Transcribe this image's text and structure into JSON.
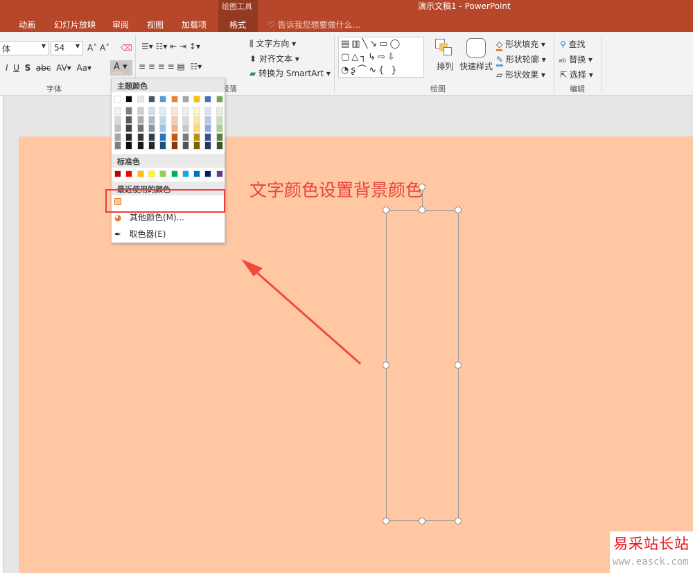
{
  "window": {
    "title": "演示文稿1 - PowerPoint",
    "context_group": "绘图工具"
  },
  "tabs": [
    "动画",
    "幻灯片放映",
    "审阅",
    "视图",
    "加载项",
    "格式"
  ],
  "tell_me": "告诉我您想要做什么...",
  "font": {
    "name": "体",
    "size": "54",
    "group_label": "字体"
  },
  "paragraph": {
    "text_direction": "文字方向",
    "align_text": "对齐文本",
    "smartart": "转换为 SmartArt",
    "group_label": "段落"
  },
  "drawing": {
    "arrange": "排列",
    "quick_styles": "快速样式",
    "shape_fill": "形状填充",
    "shape_outline": "形状轮廓",
    "shape_effects": "形状效果",
    "group_label": "绘图"
  },
  "editing": {
    "find": "查找",
    "replace": "替换",
    "select": "选择",
    "group_label": "编辑"
  },
  "color_menu": {
    "theme_label": "主题颜色",
    "theme_colors": [
      "#FFFFFF",
      "#000000",
      "#E7E6E6",
      "#44546A",
      "#5B9BD5",
      "#ED7D31",
      "#A5A5A5",
      "#FFC000",
      "#4472C4",
      "#70AD47"
    ],
    "theme_shades": [
      [
        "#F2F2F2",
        "#D9D9D9",
        "#BFBFBF",
        "#A6A6A6",
        "#808080"
      ],
      [
        "#808080",
        "#595959",
        "#404040",
        "#262626",
        "#0D0D0D"
      ],
      [
        "#D0CECE",
        "#AEABAB",
        "#757171",
        "#3A3838",
        "#171616"
      ],
      [
        "#D6DCE5",
        "#ADB9CA",
        "#8497B0",
        "#333F50",
        "#222A35"
      ],
      [
        "#DEEBF7",
        "#BDD7EE",
        "#9DC3E6",
        "#2E75B6",
        "#1F4E79"
      ],
      [
        "#FBE5D6",
        "#F8CBAD",
        "#F4B183",
        "#C55A11",
        "#843C0C"
      ],
      [
        "#EDEDED",
        "#DBDBDB",
        "#C9C9C9",
        "#7B7B7B",
        "#525252"
      ],
      [
        "#FFF2CC",
        "#FFE699",
        "#FFD966",
        "#BF9000",
        "#7F6000"
      ],
      [
        "#DAE3F3",
        "#B4C7E7",
        "#8FAADC",
        "#2F5597",
        "#203864"
      ],
      [
        "#E2F0D9",
        "#C5E0B4",
        "#A9D18E",
        "#548235",
        "#385723"
      ]
    ],
    "standard_label": "标准色",
    "standard_colors": [
      "#C00000",
      "#FF0000",
      "#FFC000",
      "#FFFF00",
      "#92D050",
      "#00B050",
      "#00B0F0",
      "#0070C0",
      "#002060",
      "#7030A0"
    ],
    "recent_label": "最近使用的颜色",
    "recent_colors": [
      "#FFC8A2"
    ],
    "more_colors": "其他颜色(M)...",
    "eyedropper": "取色器(E)"
  },
  "slide": {
    "background": "#FFC8A2",
    "annotation": "文字颜色设置背景颜色"
  },
  "watermark": {
    "brand": "易采站长站",
    "url": "www.easck.com"
  }
}
